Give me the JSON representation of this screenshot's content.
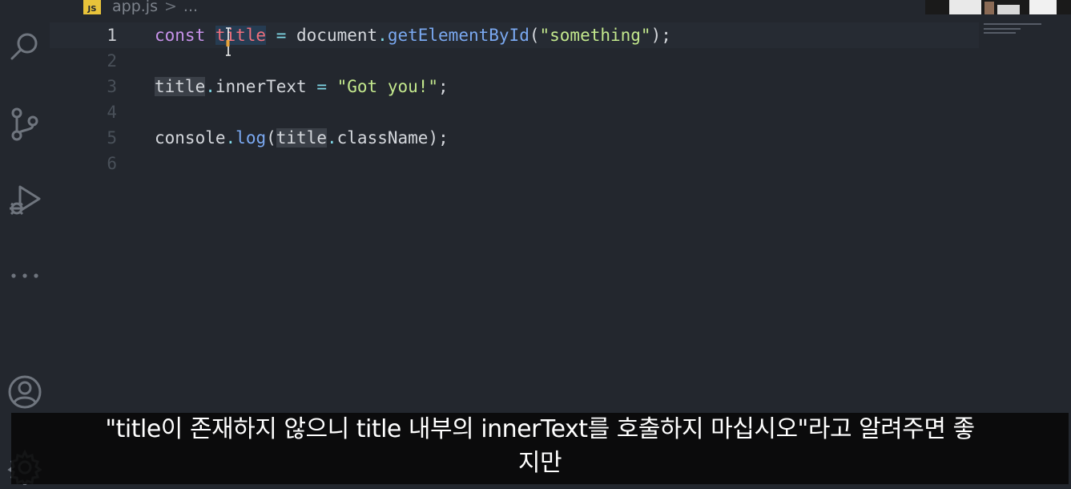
{
  "breadcrumb": {
    "badge": "JS",
    "file": "app.js",
    "separator": ">",
    "more": "..."
  },
  "activity_bar": {
    "icons": [
      "search-icon",
      "source-control-icon",
      "run-debug-icon",
      "more-icon",
      "account-icon",
      "settings-gear-icon"
    ]
  },
  "editor": {
    "lines": [
      {
        "number": "1",
        "tokens": [
          {
            "text": "const ",
            "type": "kw"
          },
          {
            "text": "title",
            "type": "var-red"
          },
          {
            "text": " = ",
            "type": "op"
          },
          {
            "text": "document",
            "type": "plain"
          },
          {
            "text": ".",
            "type": "op"
          },
          {
            "text": "getElementById",
            "type": "fn"
          },
          {
            "text": "(",
            "type": "plain"
          },
          {
            "text": "\"something\"",
            "type": "str"
          },
          {
            "text": ");",
            "type": "plain"
          }
        ]
      },
      {
        "number": "2",
        "tokens": []
      },
      {
        "number": "3",
        "tokens": [
          {
            "text": "title",
            "type": "plain"
          },
          {
            "text": ".",
            "type": "op"
          },
          {
            "text": "innerText",
            "type": "plain"
          },
          {
            "text": " = ",
            "type": "op"
          },
          {
            "text": "\"Got you!\"",
            "type": "str"
          },
          {
            "text": ";",
            "type": "plain"
          }
        ]
      },
      {
        "number": "4",
        "tokens": []
      },
      {
        "number": "5",
        "tokens": [
          {
            "text": "console",
            "type": "plain"
          },
          {
            "text": ".",
            "type": "op"
          },
          {
            "text": "log",
            "type": "fn"
          },
          {
            "text": "(",
            "type": "plain"
          },
          {
            "text": "title",
            "type": "plain"
          },
          {
            "text": ".",
            "type": "op"
          },
          {
            "text": "className",
            "type": "plain"
          },
          {
            "text": ");",
            "type": "plain"
          }
        ]
      },
      {
        "number": "6",
        "tokens": []
      }
    ]
  },
  "subtitle": {
    "line1": "\"title이 존재하지 않으니 title 내부의 innerText를 호출하지 마십시오\"라고 알려주면 좋",
    "line2": "지만"
  },
  "colors": {
    "background": "#23272e",
    "keyword": "#c792ea",
    "variable": "#ef6f7c",
    "operator": "#7fd7e6",
    "function": "#7aa8f0",
    "string": "#c3e88d",
    "js_badge": "#e8c33a"
  }
}
